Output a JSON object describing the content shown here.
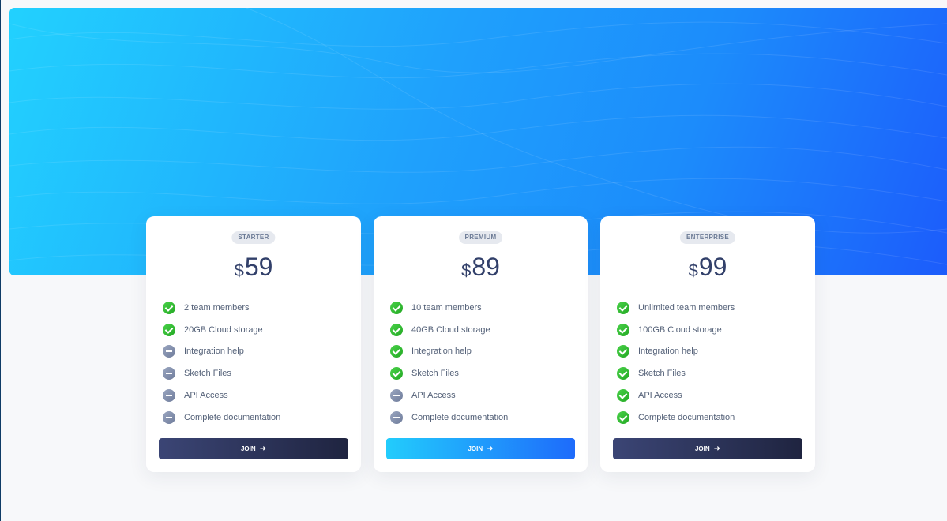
{
  "colors": {
    "hero_gradient_start": "#22d1fe",
    "hero_gradient_end": "#1c5cfb",
    "check_green": "#34c034",
    "inactive_gray": "#7d89a8",
    "dark_button": "#2b3154",
    "price_text": "#32406a"
  },
  "plans": [
    {
      "name": "STARTER",
      "currency": "$",
      "price": "59",
      "features": [
        {
          "label": "2 team members",
          "included": true,
          "icon": "check-icon"
        },
        {
          "label": "20GB Cloud storage",
          "included": true,
          "icon": "check-icon"
        },
        {
          "label": "Integration help",
          "included": false,
          "icon": "minus-icon"
        },
        {
          "label": "Sketch Files",
          "included": false,
          "icon": "minus-icon"
        },
        {
          "label": "API Access",
          "included": false,
          "icon": "minus-icon"
        },
        {
          "label": "Complete documentation",
          "included": false,
          "icon": "minus-icon"
        }
      ],
      "button": {
        "label": "JOIN",
        "style": "dark",
        "icon": "arrow-right-icon"
      }
    },
    {
      "name": "PREMIUM",
      "currency": "$",
      "price": "89",
      "features": [
        {
          "label": "10 team members",
          "included": true,
          "icon": "check-icon"
        },
        {
          "label": "40GB Cloud storage",
          "included": true,
          "icon": "check-icon"
        },
        {
          "label": "Integration help",
          "included": true,
          "icon": "check-icon"
        },
        {
          "label": "Sketch Files",
          "included": true,
          "icon": "check-icon"
        },
        {
          "label": "API Access",
          "included": false,
          "icon": "minus-icon"
        },
        {
          "label": "Complete documentation",
          "included": false,
          "icon": "minus-icon"
        }
      ],
      "button": {
        "label": "JOIN",
        "style": "blue",
        "icon": "arrow-right-icon"
      }
    },
    {
      "name": "ENTERPRISE",
      "currency": "$",
      "price": "99",
      "features": [
        {
          "label": "Unlimited team members",
          "included": true,
          "icon": "check-icon"
        },
        {
          "label": "100GB Cloud storage",
          "included": true,
          "icon": "check-icon"
        },
        {
          "label": "Integration help",
          "included": true,
          "icon": "check-icon"
        },
        {
          "label": "Sketch Files",
          "included": true,
          "icon": "check-icon"
        },
        {
          "label": "API Access",
          "included": true,
          "icon": "check-icon"
        },
        {
          "label": "Complete documentation",
          "included": true,
          "icon": "check-icon"
        }
      ],
      "button": {
        "label": "JOIN",
        "style": "dark",
        "icon": "arrow-right-icon"
      }
    }
  ]
}
